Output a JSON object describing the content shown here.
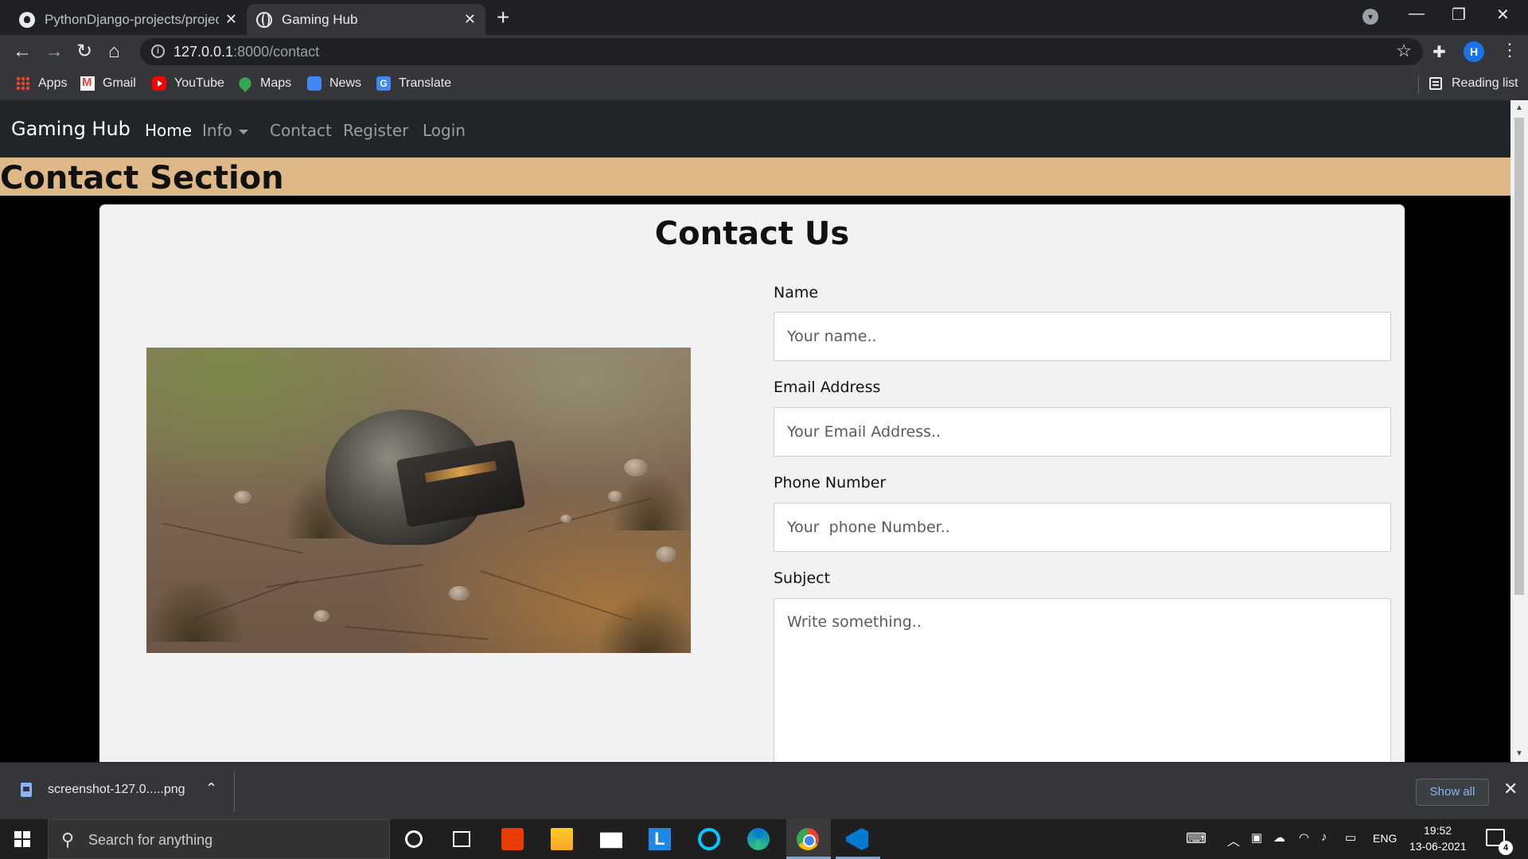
{
  "browser": {
    "tabs": [
      {
        "title": "PythonDjango-projects/project1/",
        "icon": "github-icon",
        "active": false
      },
      {
        "title": "Gaming Hub",
        "icon": "globe-icon",
        "active": true
      }
    ],
    "url": {
      "host": "127.0.0.1",
      "path": ":8000/contact"
    },
    "bookmarks": [
      "Apps",
      "Gmail",
      "YouTube",
      "Maps",
      "News",
      "Translate"
    ],
    "reading_list": "Reading list",
    "profile_initial": "H"
  },
  "site": {
    "brand": "Gaming Hub",
    "nav": [
      {
        "label": "Home",
        "active": true
      },
      {
        "label": "Info",
        "dropdown": true
      },
      {
        "label": "Contact"
      },
      {
        "label": "Register"
      },
      {
        "label": "Login"
      }
    ],
    "section_title": "Contact Section",
    "section_color": "#deb887",
    "card_title": "Contact Us",
    "form": {
      "name_label": "Name",
      "name_placeholder": "Your name..",
      "email_label": "Email Address",
      "email_placeholder": "Your Email Address..",
      "phone_label": "Phone Number",
      "phone_placeholder": "Your  phone Number..",
      "subject_label": "Subject",
      "subject_placeholder": "Write something.."
    }
  },
  "downloads": {
    "file": "screenshot-127.0.....png",
    "show_all": "Show all"
  },
  "taskbar": {
    "search_placeholder": "Search for anything",
    "lang": "ENG",
    "time": "19:52",
    "date": "13-06-2021",
    "notifications": "4"
  }
}
